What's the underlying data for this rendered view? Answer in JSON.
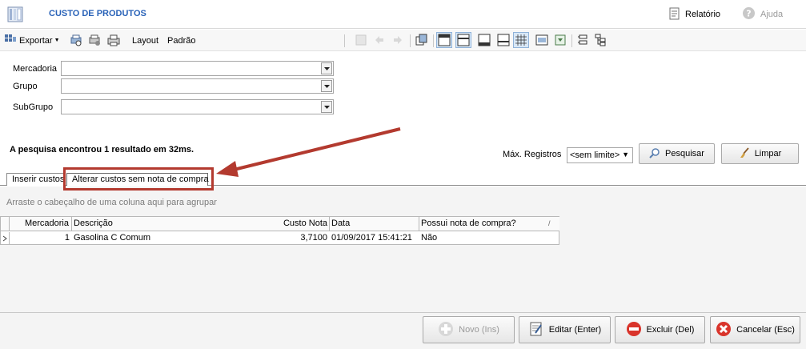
{
  "header": {
    "title": "CUSTO DE PRODUTOS",
    "report_label": "Relatório",
    "help_label": "Ajuda"
  },
  "toolbar": {
    "export_label": "Exportar",
    "layout_label": "Layout",
    "layout_value": "Padrão"
  },
  "filters": {
    "mercadoria_label": "Mercadoria",
    "grupo_label": "Grupo",
    "subgrupo_label": "SubGrupo",
    "mercadoria_value": "",
    "grupo_value": "",
    "subgrupo_value": ""
  },
  "search": {
    "result_text": "A pesquisa encontrou 1 resultado em 32ms.",
    "max_label": "Máx. Registros",
    "max_value": "<sem limite>",
    "search_button": "Pesquisar",
    "clear_button": "Limpar"
  },
  "tabs": [
    {
      "label": "Inserir custos"
    },
    {
      "label": "Alterar custos sem nota de compra"
    }
  ],
  "grid": {
    "group_hint": "Arraste o cabeçalho de uma coluna aqui para agrupar",
    "columns": [
      "Mercadoria",
      "Descrição",
      "Custo Nota",
      "Data",
      "Possui nota de compra?"
    ],
    "rows": [
      {
        "mercadoria": "1",
        "descricao": "Gasolina C Comum",
        "custo": "3,7100",
        "data": "01/09/2017 15:41:21",
        "possui": "Não"
      }
    ]
  },
  "footer": {
    "new_button": "Novo (Ins)",
    "edit_button": "Editar (Enter)",
    "delete_button": "Excluir (Del)",
    "cancel_button": "Cancelar (Esc)"
  },
  "colors": {
    "title": "#2a63b8",
    "annotation": "#b33a2f"
  }
}
